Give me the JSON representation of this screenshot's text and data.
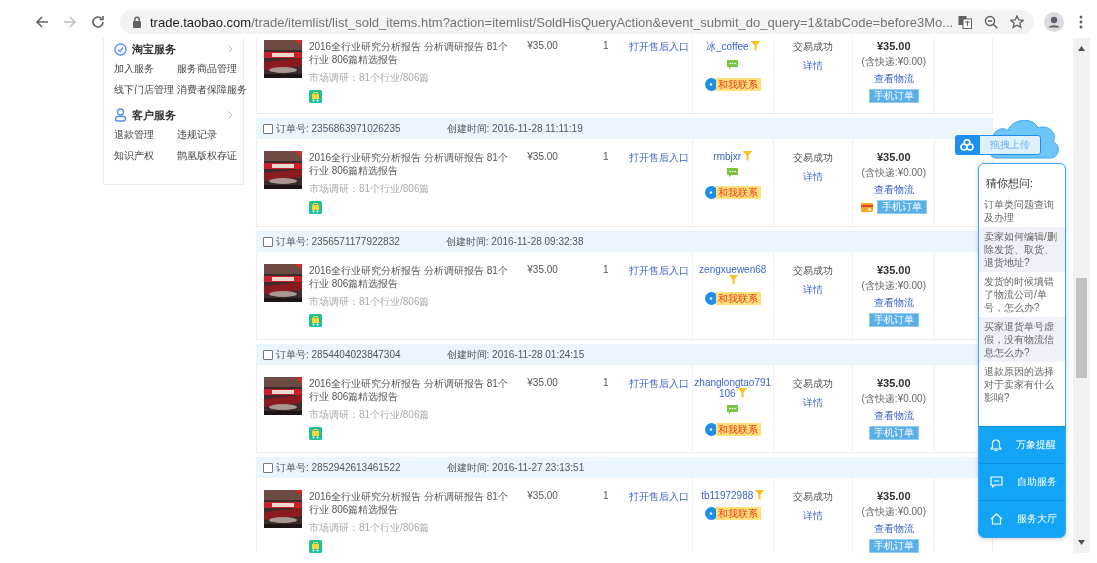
{
  "browser": {
    "host": "trade.taobao.com",
    "path": "/trade/itemlist/list_sold_items.htm?action=itemlist/SoldHisQueryAction&event_submit_do_query=1&tabCode=before3Mo..."
  },
  "sidebar": {
    "sections": [
      {
        "title": "淘宝服务",
        "items": [
          "加入服务",
          "服务商品管理",
          "线下门店管理",
          "消费者保障服务"
        ]
      },
      {
        "title": "客户服务",
        "items": [
          "退款管理",
          "违规记录",
          "知识产权",
          "鹊凰版权存证"
        ]
      }
    ]
  },
  "orders": [
    {
      "item": {
        "title": "2016全行业研究分析报告 分析调研报告 81个行业 806篇精选报告",
        "spec": "市场调研：81个行业/806篇",
        "price": "¥35.00",
        "quantity": "1",
        "after_sale": "打开售后入口",
        "seller": "冰_coffee",
        "has_chat": true,
        "contact": "和我联系",
        "status": "交易成功",
        "detail": "详情",
        "total": "¥35.00",
        "shipping": "(含快递:¥0.00)",
        "logistics": "查看物流",
        "has_card": false,
        "mobile": "手机订单"
      }
    },
    {
      "header": {
        "checked": false,
        "order_no": "订单号: 2356863971026235",
        "created": "创建时间: 2016-11-28 11:11:19"
      },
      "item": {
        "title": "2016全行业研究分析报告 分析调研报告 81个行业 806篇精选报告",
        "spec": "市场调研：81个行业/806篇",
        "price": "¥35.00",
        "quantity": "1",
        "after_sale": "打开售后入口",
        "seller": "rmbjxr",
        "has_chat": true,
        "contact": "和我联系",
        "status": "交易成功",
        "detail": "详情",
        "total": "¥35.00",
        "shipping": "(含快递:¥0.00)",
        "logistics": "查看物流",
        "has_card": true,
        "mobile": "手机订单"
      }
    },
    {
      "header": {
        "checked": false,
        "order_no": "订单号: 2356571177922832",
        "created": "创建时间: 2016-11-28 09:32:38"
      },
      "item": {
        "title": "2016全行业研究分析报告 分析调研报告 81个行业 806篇精选报告",
        "spec": "市场调研：81个行业/806篇",
        "price": "¥35.00",
        "quantity": "1",
        "after_sale": "打开售后入口",
        "seller": "zengxuewen68",
        "has_chat": false,
        "contact": "和我联系",
        "status": "交易成功",
        "detail": "详情",
        "total": "¥35.00",
        "shipping": "(含快递:¥0.00)",
        "logistics": "查看物流",
        "has_card": false,
        "mobile": "手机订单"
      }
    },
    {
      "header": {
        "checked": false,
        "order_no": "订单号: 2854404023847304",
        "created": "创建时间: 2016-11-28 01:24:15"
      },
      "item": {
        "title": "2016全行业研究分析报告 分析调研报告 81个行业 806篇精选报告",
        "spec": "市场调研：81个行业/806篇",
        "price": "¥35.00",
        "quantity": "1",
        "after_sale": "打开售后入口",
        "seller": "zhanglongtao791106",
        "has_chat": true,
        "contact": "和我联系",
        "status": "交易成功",
        "detail": "详情",
        "total": "¥35.00",
        "shipping": "(含快递:¥0.00)",
        "logistics": "查看物流",
        "has_card": false,
        "mobile": "手机订单"
      }
    },
    {
      "header": {
        "checked": false,
        "order_no": "订单号: 2852942613461522",
        "created": "创建时间: 2016-11-27 23:13:51"
      },
      "item": {
        "title": "2016全行业研究分析报告 分析调研报告 81个行业 806篇精选报告",
        "spec": "市场调研：81个行业/806篇",
        "price": "¥35.00",
        "quantity": "1",
        "after_sale": "打开售后入口",
        "seller": "tb11972988",
        "has_chat": false,
        "contact": "和我联系",
        "status": "交易成功",
        "detail": "详情",
        "total": "¥35.00",
        "shipping": "(含快递:¥0.00)",
        "logistics": "查看物流",
        "has_card": false,
        "mobile": "手机订单"
      }
    }
  ],
  "upload": {
    "label": "拖拽上传"
  },
  "help_panel": {
    "title": "猜你想问:",
    "questions": [
      "订单类问题查询及办理",
      "卖家如何编辑/删除发货、取货、退货地址?",
      "发货的时候填错了物流公司/单号，怎么办?",
      "买家退货单号虚假，没有物流信息怎么办?",
      "退款原因的选择对于卖家有什么影响?"
    ],
    "actions": [
      {
        "kind": "bell",
        "label": "万象提醒"
      },
      {
        "kind": "message",
        "label": "自助服务"
      },
      {
        "kind": "home",
        "label": "服务大厅"
      }
    ]
  }
}
